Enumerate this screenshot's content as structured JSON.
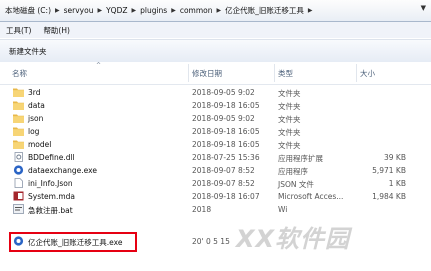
{
  "address": {
    "crumbs": [
      "本地磁盘 (C:)",
      "servyou",
      "YQDZ",
      "plugins",
      "common",
      "亿企代账_旧账迁移工具"
    ]
  },
  "menu": [
    "工具(T)",
    "帮助(H)"
  ],
  "toolbar": {
    "new_folder": "新建文件夹"
  },
  "columns": {
    "name": "名称",
    "date": "修改日期",
    "type": "类型",
    "size": "大小"
  },
  "files": [
    {
      "name": "3rd",
      "date": "2018-09-05 9:02",
      "type": "文件夹",
      "size": "",
      "icon": "folder-icon"
    },
    {
      "name": "data",
      "date": "2018-09-18 16:05",
      "type": "文件夹",
      "size": "",
      "icon": "folder-icon"
    },
    {
      "name": "json",
      "date": "2018-09-05 9:02",
      "type": "文件夹",
      "size": "",
      "icon": "folder-icon"
    },
    {
      "name": "log",
      "date": "2018-09-18 16:05",
      "type": "文件夹",
      "size": "",
      "icon": "folder-icon"
    },
    {
      "name": "model",
      "date": "2018-09-18 16:05",
      "type": "文件夹",
      "size": "",
      "icon": "folder-icon"
    },
    {
      "name": "BDDefine.dll",
      "date": "2018-07-25 15:36",
      "type": "应用程序扩展",
      "size": "39 KB",
      "icon": "dll-icon"
    },
    {
      "name": "dataexchange.exe",
      "date": "2018-09-07 8:52",
      "type": "应用程序",
      "size": "5,971 KB",
      "icon": "exe-icon"
    },
    {
      "name": "ini_Info.Json",
      "date": "2018-09-07 8:52",
      "type": "JSON 文件",
      "size": "1 KB",
      "icon": "file-icon"
    },
    {
      "name": "System.mda",
      "date": "2018-09-18 16:07",
      "type": "Microsoft Acces...",
      "size": "1,984 KB",
      "icon": "access-icon"
    },
    {
      "name": "急救注册.bat",
      "date": "2018",
      "type": "Wi",
      "size": "",
      "icon": "bat-icon"
    },
    {
      "name": "亿企代账_旧账迁移工具.exe",
      "date": "20'  0  5  15",
      "type": "",
      "size": "",
      "icon": "exe-icon"
    }
  ],
  "watermark": "XX软件园"
}
